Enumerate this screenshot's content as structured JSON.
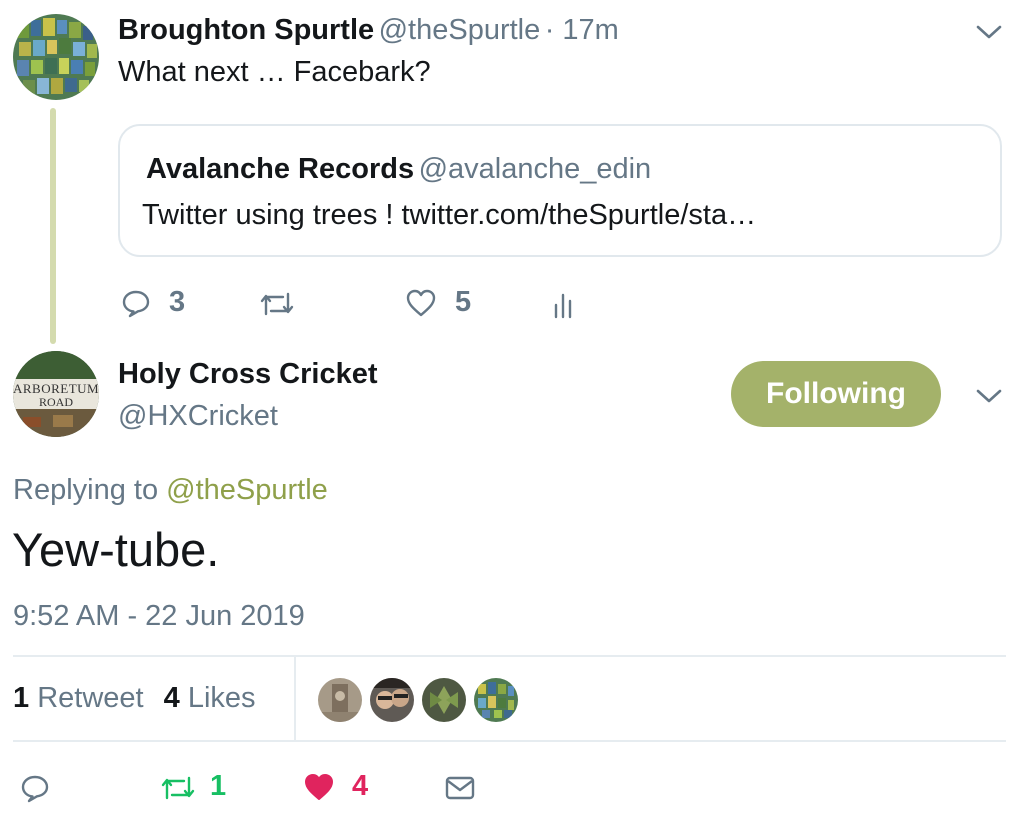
{
  "parent_tweet": {
    "display_name": "Broughton Spurtle",
    "handle": "@theSpurtle",
    "time": "· 17m",
    "text": "What next … Facebark?",
    "quoted": {
      "display_name": "Avalanche Records",
      "handle": "@avalanche_edin",
      "text": "Twitter using trees ! twitter.com/theSpurtle/sta…"
    },
    "actions": {
      "replies": "3",
      "likes": "5"
    }
  },
  "main_tweet": {
    "display_name": "Holy Cross Cricket",
    "handle": "@HXCricket",
    "follow_label": "Following",
    "avatar_sign": {
      "line1": "ARBORETUM",
      "line2": "ROAD"
    },
    "replying_prefix": "Replying to",
    "replying_handle": "@theSpurtle",
    "text": "Yew-tube.",
    "timestamp": "9:52 AM - 22 Jun 2019",
    "stats": {
      "retweet_count": "1",
      "retweet_label": "Retweet",
      "like_count": "4",
      "like_label": "Likes"
    },
    "actions": {
      "retweets": "1",
      "likes": "4"
    }
  },
  "colors": {
    "accent": "#a4b26a",
    "link": "#8fa04a",
    "muted": "#657786",
    "retweet_green": "#17bf63",
    "like_red": "#e0245e",
    "thread_line": "#d4dbae"
  },
  "icons": [
    "chevron-down-icon",
    "reply-icon",
    "retweet-icon",
    "heart-icon",
    "analytics-icon",
    "envelope-icon"
  ]
}
